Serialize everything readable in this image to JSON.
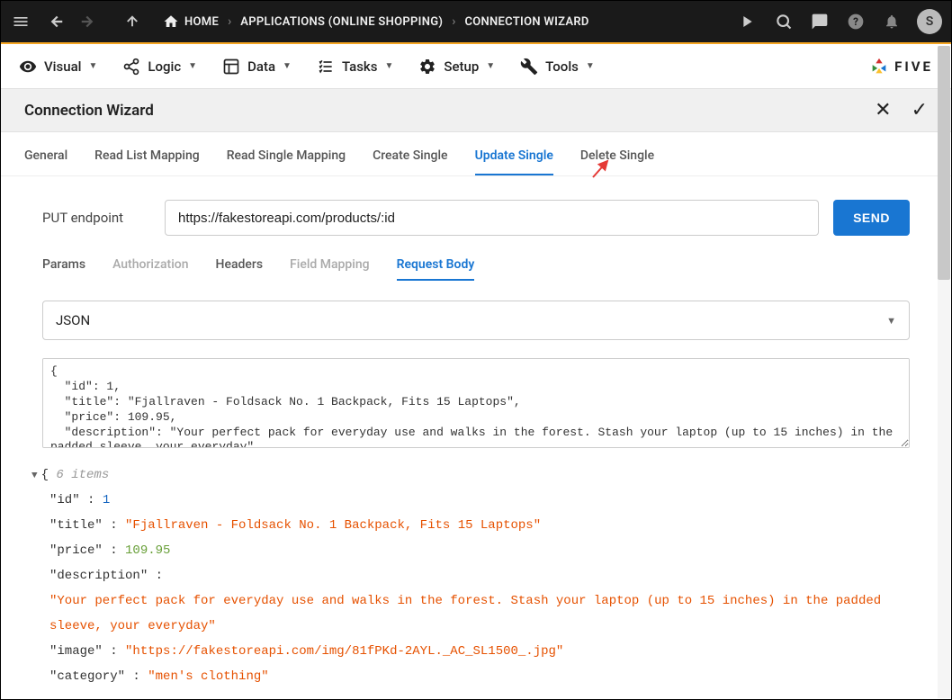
{
  "topbar": {
    "breadcrumb": [
      {
        "icon": "home",
        "label": "HOME"
      },
      {
        "label": "APPLICATIONS (ONLINE SHOPPING)"
      },
      {
        "label": "CONNECTION WIZARD"
      }
    ],
    "avatar_letter": "S"
  },
  "menubar": {
    "items": [
      {
        "icon": "eye",
        "label": "Visual"
      },
      {
        "icon": "share",
        "label": "Logic"
      },
      {
        "icon": "grid",
        "label": "Data"
      },
      {
        "icon": "list",
        "label": "Tasks"
      },
      {
        "icon": "gear",
        "label": "Setup"
      },
      {
        "icon": "wrench",
        "label": "Tools"
      }
    ],
    "logo_text": "FIVE"
  },
  "panel": {
    "title": "Connection Wizard"
  },
  "tabs": {
    "items": [
      {
        "label": "General",
        "active": false
      },
      {
        "label": "Read List Mapping",
        "active": false
      },
      {
        "label": "Read Single Mapping",
        "active": false
      },
      {
        "label": "Create Single",
        "active": false
      },
      {
        "label": "Update Single",
        "active": true
      },
      {
        "label": "Delete Single",
        "active": false
      }
    ]
  },
  "endpoint": {
    "label": "PUT endpoint",
    "value": "https://fakestoreapi.com/products/:id",
    "send": "SEND"
  },
  "subtabs": {
    "items": [
      {
        "label": "Params",
        "active": false,
        "muted": false
      },
      {
        "label": "Authorization",
        "active": false,
        "muted": true
      },
      {
        "label": "Headers",
        "active": false,
        "muted": false
      },
      {
        "label": "Field Mapping",
        "active": false,
        "muted": true
      },
      {
        "label": "Request Body",
        "active": true,
        "muted": false
      }
    ]
  },
  "body_type": {
    "selected": "JSON"
  },
  "request_body": "{\n  \"id\": 1,\n  \"title\": \"Fjallraven - Foldsack No. 1 Backpack, Fits 15 Laptops\",\n  \"price\": 109.95,\n  \"description\": \"Your perfect pack for everyday use and walks in the forest. Stash your laptop (up to 15 inches) in the padded sleeve, your everyday\",",
  "json_viewer": {
    "item_count_label": "6 items",
    "rows": [
      {
        "key": "id",
        "value": "1",
        "type": "num"
      },
      {
        "key": "title",
        "value": "\"Fjallraven - Foldsack No. 1 Backpack, Fits 15 Laptops\"",
        "type": "str"
      },
      {
        "key": "price",
        "value": "109.95",
        "type": "numgreen"
      },
      {
        "key": "description",
        "value": "\"Your perfect pack for everyday use and walks in the forest. Stash your laptop (up to 15 inches) in the padded sleeve, your everyday\"",
        "type": "str",
        "wrap": true
      },
      {
        "key": "image",
        "value": "\"https://fakestoreapi.com/img/81fPKd-2AYL._AC_SL1500_.jpg\"",
        "type": "str"
      },
      {
        "key": "category",
        "value": "\"men's clothing\"",
        "type": "str"
      }
    ]
  }
}
